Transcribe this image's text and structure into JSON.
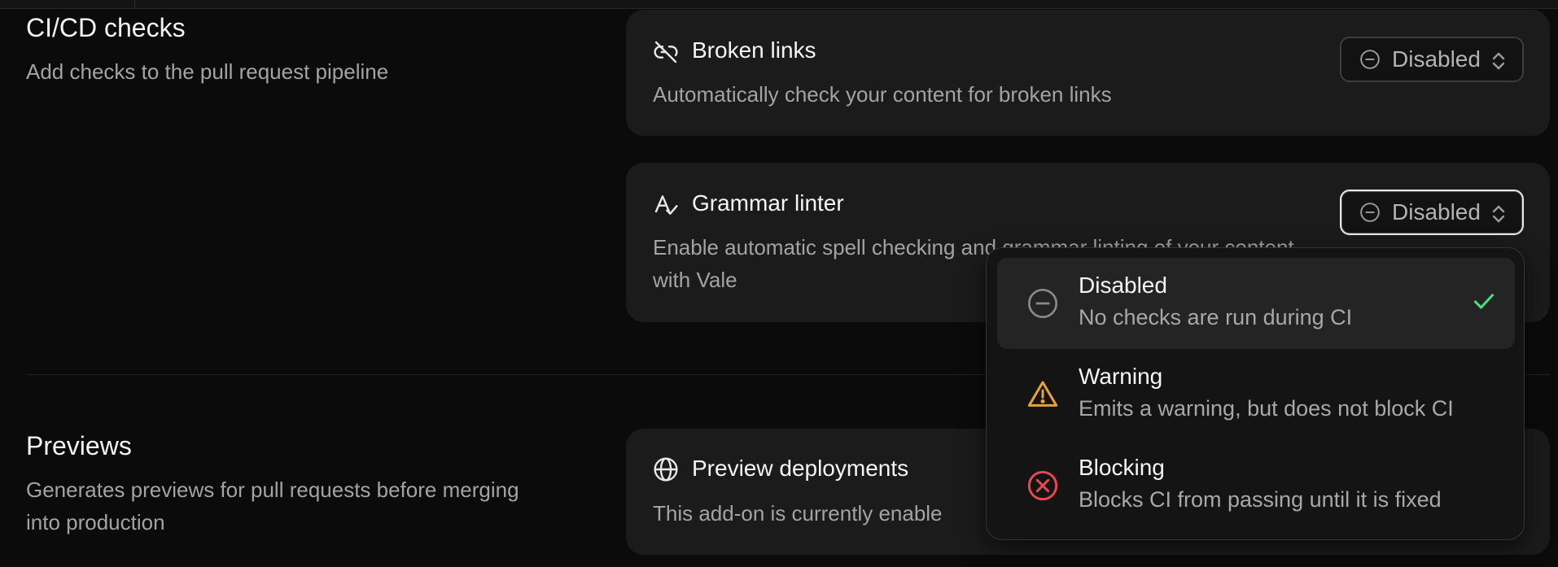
{
  "cicd": {
    "title": "CI/CD checks",
    "description": "Add checks to the pull request pipeline"
  },
  "broken_links": {
    "title": "Broken links",
    "description": "Automatically check your content for broken links",
    "select_value": "Disabled",
    "icon": "broken-link-icon"
  },
  "grammar": {
    "title": "Grammar linter",
    "description": "Enable automatic spell checking and grammar linting of your content with Vale",
    "select_value": "Disabled",
    "icon": "spellcheck-icon"
  },
  "previews": {
    "title": "Previews",
    "description": "Generates previews for pull requests before merging into production"
  },
  "preview_deployments": {
    "title": "Preview deployments",
    "description": "This add-on is currently enable",
    "icon": "globe-icon"
  },
  "dropdown": {
    "options": [
      {
        "title": "Disabled",
        "description": "No checks are run during CI",
        "icon": "minus-circle-icon",
        "selected": true
      },
      {
        "title": "Warning",
        "description": "Emits a warning, but does not block CI",
        "icon": "warning-triangle-icon",
        "color": "#e8a23a"
      },
      {
        "title": "Blocking",
        "description": "Blocks CI from passing until it is fixed",
        "icon": "x-circle-icon",
        "color": "#e5484d"
      }
    ],
    "check_color": "#4ade80"
  }
}
